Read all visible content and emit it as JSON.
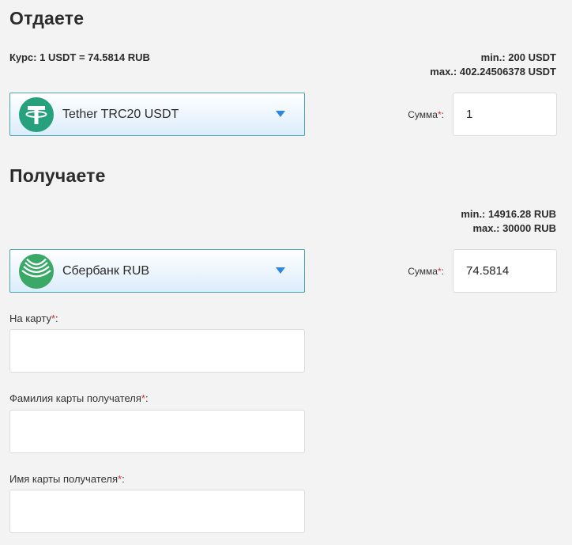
{
  "give": {
    "title": "Отдаете",
    "rate": "Курс: 1 USDT = 74.5814 RUB",
    "min": "min.: 200 USDT",
    "max": "max.: 402.24506378 USDT",
    "currency": {
      "label": "Tether TRC20 USDT",
      "icon": "tether-icon",
      "color": "#26a17b"
    },
    "amount_label": "Сумма",
    "amount_value": "1"
  },
  "receive": {
    "title": "Получаете",
    "min": "min.: 14916.28 RUB",
    "max": "max.: 30000 RUB",
    "currency": {
      "label": "Сбербанк RUB",
      "icon": "sberbank-icon",
      "color": "#2f9f5a"
    },
    "amount_label": "Сумма",
    "amount_value": "74.5814"
  },
  "fields": {
    "card_label": "На карту",
    "surname_label": "Фамилия карты получателя",
    "name_label": "Имя карты получателя"
  },
  "required_mark": "*",
  "colon": ":"
}
